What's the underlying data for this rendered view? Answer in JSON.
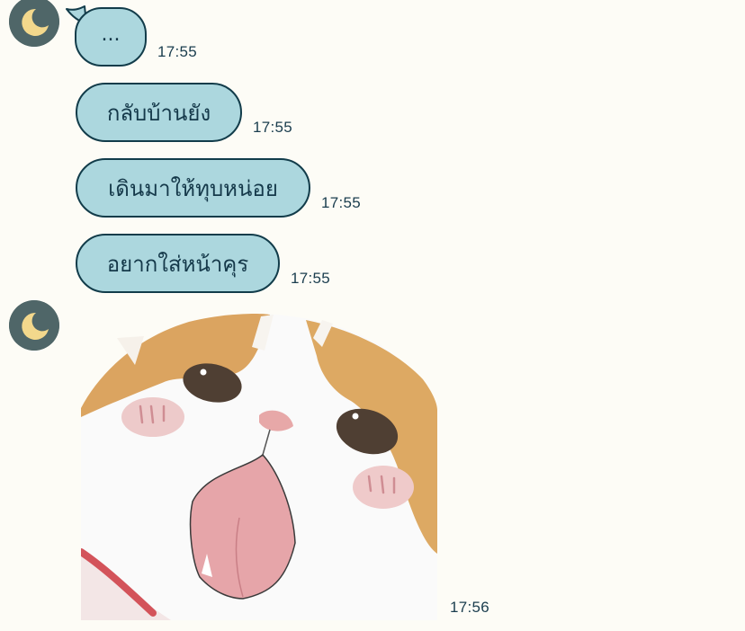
{
  "chat": {
    "messages": [
      {
        "text": "...",
        "time": "17:55"
      },
      {
        "text": "กลับบ้านยัง",
        "time": "17:55"
      },
      {
        "text": "เดินมาให้ทุบหน่อย",
        "time": "17:55"
      },
      {
        "text": "อยากใส่หน้าคุร",
        "time": "17:55"
      }
    ],
    "sticker": {
      "time": "17:56",
      "icon": "cat-sticker"
    },
    "avatar_icon": "crescent-moon-icon"
  },
  "colors": {
    "background": "#fdfcf6",
    "bubble_fill": "#acd7de",
    "bubble_border": "#123c4a",
    "avatar_bg": "#4f6668",
    "moon": "#f3d88c"
  }
}
